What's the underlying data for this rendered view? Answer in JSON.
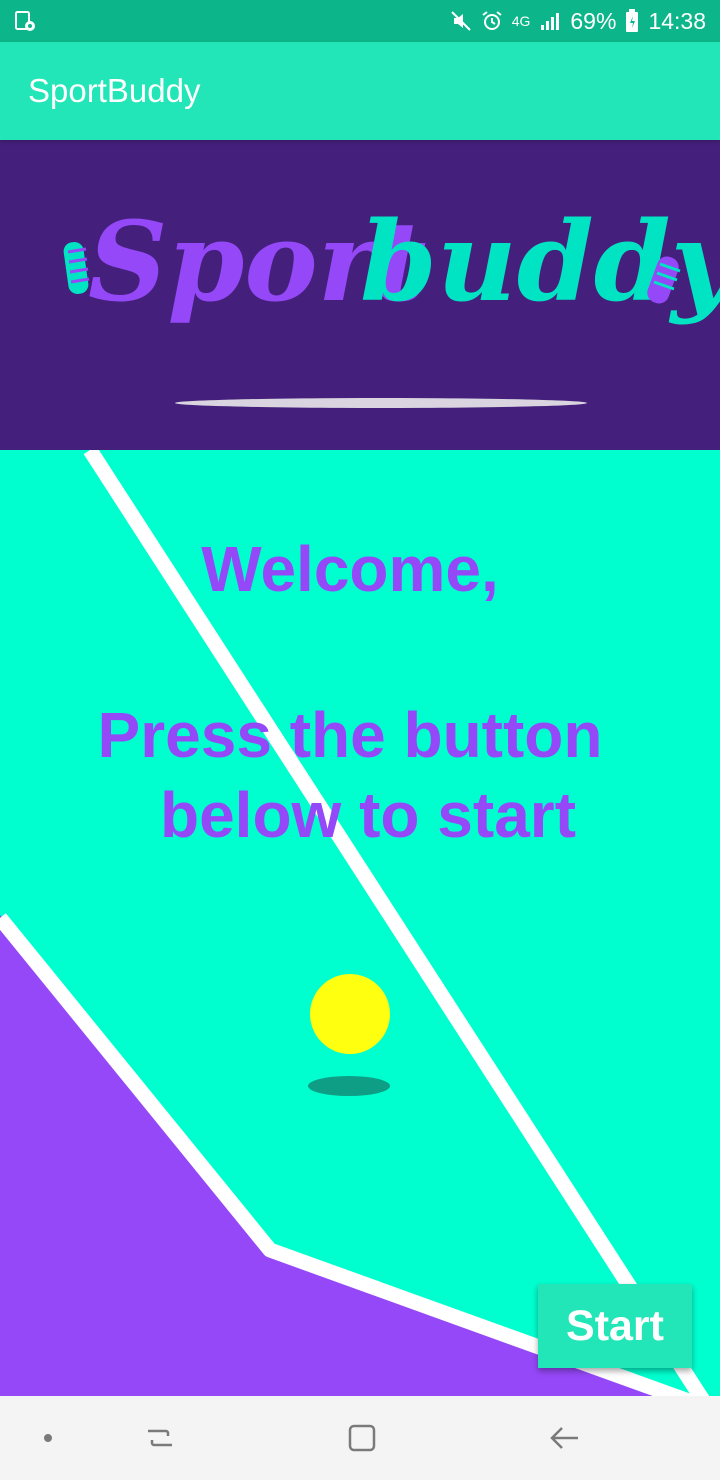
{
  "status_bar": {
    "network": "4G",
    "battery": "69%",
    "time": "14:38",
    "icons": [
      "screen-record-icon",
      "mute-icon",
      "alarm-icon",
      "signal-icon",
      "battery-icon"
    ]
  },
  "app_bar": {
    "title": "SportBuddy"
  },
  "banner": {
    "logo_part1": "Sport",
    "logo_part2": "buddy",
    "colors": {
      "background": "#44207c",
      "part1": "#9548f8",
      "part2": "#00e4c4"
    }
  },
  "main": {
    "welcome": "Welcome,",
    "instruction_line1": "Press the button",
    "instruction_line2": "below to start",
    "start_label": "Start",
    "colors": {
      "court": "#00ffcf",
      "outside": "#9548f8",
      "ball": "#ffff10",
      "text": "#9548f8",
      "button": "#22e6b8"
    }
  },
  "nav_bar": {
    "items": [
      "dot-icon",
      "recent-apps-icon",
      "home-icon",
      "back-icon"
    ]
  }
}
